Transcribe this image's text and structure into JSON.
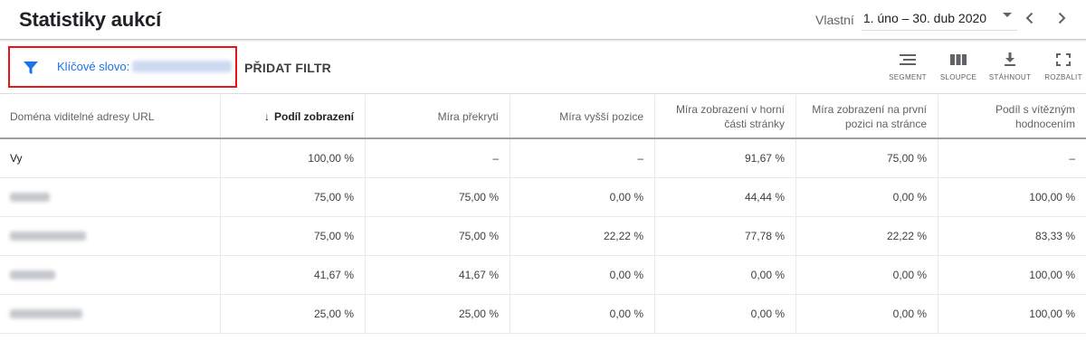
{
  "header": {
    "title": "Statistiky aukcí",
    "date_type": "Vlastní",
    "date_range": "1. úno – 30. dub 2020"
  },
  "toolbar": {
    "filter_label": "Klíčové slovo:",
    "add_filter": "PŘIDAT FILTR",
    "segment": "SEGMENT",
    "columns": "SLOUPCE",
    "download": "STÁHNOUT",
    "expand": "ROZBALIT"
  },
  "table": {
    "headers": [
      "Doména viditelné adresy URL",
      "Podíl zobrazení",
      "Míra překrytí",
      "Míra vyšší pozice",
      "Míra zobrazení v horní části stránky",
      "Míra zobrazení na první pozici na stránce",
      "Podíl s vítězným hodnocením"
    ],
    "sort_arrow": "↓",
    "rows": [
      {
        "domain": "Vy",
        "cells": [
          "100,00 %",
          "–",
          "–",
          "91,67 %",
          "75,00 %",
          "–"
        ]
      },
      {
        "domain": "",
        "cells": [
          "75,00 %",
          "75,00 %",
          "0,00 %",
          "44,44 %",
          "0,00 %",
          "100,00 %"
        ]
      },
      {
        "domain": "",
        "cells": [
          "75,00 %",
          "75,00 %",
          "22,22 %",
          "77,78 %",
          "22,22 %",
          "83,33 %"
        ]
      },
      {
        "domain": "",
        "cells": [
          "41,67 %",
          "41,67 %",
          "0,00 %",
          "0,00 %",
          "0,00 %",
          "100,00 %"
        ]
      },
      {
        "domain": "",
        "cells": [
          "25,00 %",
          "25,00 %",
          "0,00 %",
          "0,00 %",
          "0,00 %",
          "100,00 %"
        ]
      }
    ]
  },
  "colors": {
    "accent": "#1a73e8",
    "highlight_border": "#e5151b"
  },
  "icons": [
    "filter-icon",
    "segment-icon",
    "columns-icon",
    "download-icon",
    "expand-icon",
    "chevron-left-icon",
    "chevron-right-icon",
    "caret-down-icon"
  ]
}
